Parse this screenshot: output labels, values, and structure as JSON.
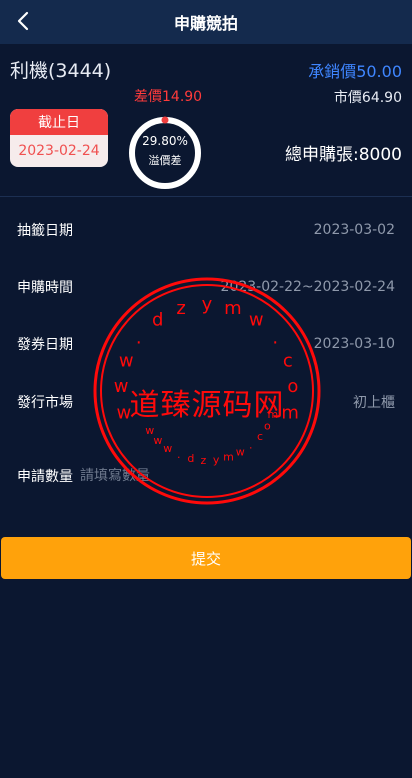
{
  "header": {
    "title": "申購競拍",
    "back_icon": "chevron-left-icon"
  },
  "summary": {
    "stock_name": "利機(3444)",
    "underwrite_price": "承銷價50.00",
    "diff_price": "差價14.90",
    "market_price": "市價64.90",
    "deadline_label": "截止日",
    "deadline_date": "2023-02-24",
    "premium_pct": "29.80%",
    "premium_label": "溢價差",
    "premium_fraction": 0.298,
    "total_apply": "總申購張:8000"
  },
  "details": [
    {
      "label": "抽籤日期",
      "value": "2023-03-02"
    },
    {
      "label": "申購時間",
      "value": "2023-02-22~2023-02-24"
    },
    {
      "label": "發券日期",
      "value": "2023-03-10"
    },
    {
      "label": "發行市場",
      "value": "初上櫃"
    }
  ],
  "quantity": {
    "label": "申請數量",
    "placeholder": "請填寫數量"
  },
  "submit_label": "提交",
  "watermark": {
    "main_text": "道臻源码网",
    "url_text": "www.dzymw.com"
  },
  "colors": {
    "background": "#0b1730",
    "header": "#142a4d",
    "accent_blue": "#3f86ff",
    "accent_red": "#f03f3f",
    "button": "#ffa20b"
  }
}
